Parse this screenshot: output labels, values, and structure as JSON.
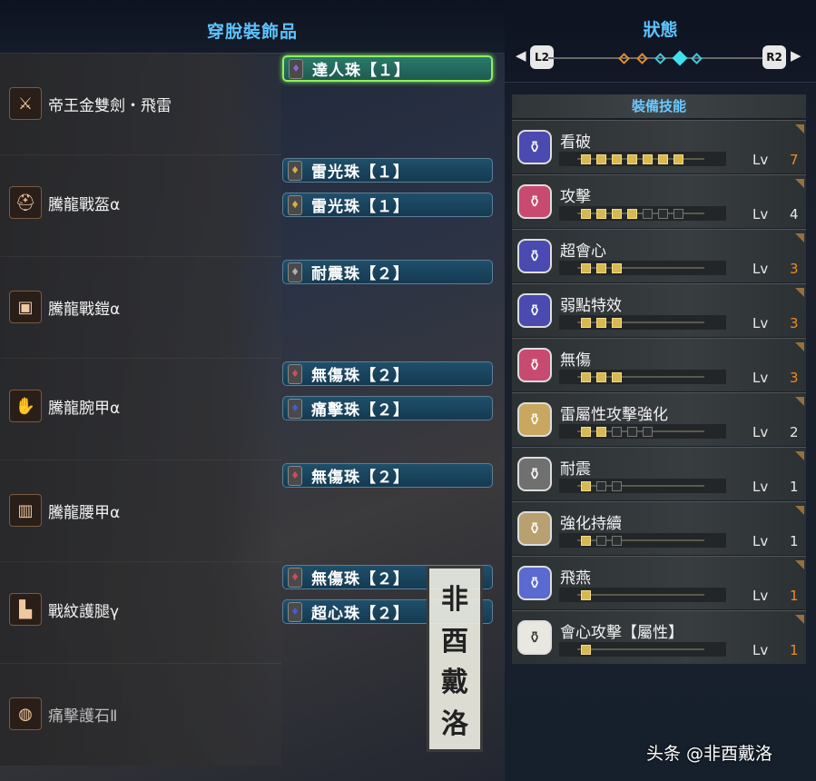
{
  "left": {
    "title": "穿脫裝飾品",
    "slots": [
      {
        "name": "帝王金雙劍・飛雷",
        "icon": "dual-blades-icon",
        "decorations": [
          {
            "label": "達人珠【１】",
            "selected": true,
            "gem": "purple"
          }
        ]
      },
      {
        "name": "騰龍戰盔α",
        "icon": "helmet-icon",
        "decorations": [
          {
            "label": "雷光珠【１】",
            "selected": false,
            "gem": "gold"
          },
          {
            "label": "雷光珠【１】",
            "selected": false,
            "gem": "gold"
          }
        ]
      },
      {
        "name": "騰龍戰鎧α",
        "icon": "chest-armor-icon",
        "decorations": [
          {
            "label": "耐震珠【２】",
            "selected": false,
            "gem": "gray"
          }
        ]
      },
      {
        "name": "騰龍腕甲α",
        "icon": "gauntlet-icon",
        "decorations": [
          {
            "label": "無傷珠【２】",
            "selected": false,
            "gem": "red"
          },
          {
            "label": "痛擊珠【２】",
            "selected": false,
            "gem": "blue"
          }
        ]
      },
      {
        "name": "騰龍腰甲α",
        "icon": "waist-armor-icon",
        "decorations": [
          {
            "label": "無傷珠【２】",
            "selected": false,
            "gem": "red"
          }
        ]
      },
      {
        "name": "戰紋護腿γ",
        "icon": "leg-armor-icon",
        "decorations": [
          {
            "label": "無傷珠【２】",
            "selected": false,
            "gem": "red"
          },
          {
            "label": "超心珠【２】",
            "selected": false,
            "gem": "blue"
          }
        ]
      },
      {
        "name": "痛擊護石Ⅱ",
        "icon": "charm-icon",
        "decorations": []
      }
    ]
  },
  "right": {
    "title": "狀態",
    "nav": {
      "left_button": "L2",
      "right_button": "R2",
      "page_count": 5,
      "active_page": 4
    },
    "skills_header": "裝備技能",
    "skills": [
      {
        "name": "看破",
        "level": 7,
        "max": 7,
        "maxed": true,
        "icon_color": "#4a4ab0"
      },
      {
        "name": "攻擊",
        "level": 4,
        "max": 7,
        "maxed": false,
        "icon_color": "#c84a70"
      },
      {
        "name": "超會心",
        "level": 3,
        "max": 3,
        "maxed": true,
        "icon_color": "#4a4ab0"
      },
      {
        "name": "弱點特效",
        "level": 3,
        "max": 3,
        "maxed": true,
        "icon_color": "#4a4ab0"
      },
      {
        "name": "無傷",
        "level": 3,
        "max": 3,
        "maxed": true,
        "icon_color": "#c84a70"
      },
      {
        "name": "雷屬性攻擊強化",
        "level": 2,
        "max": 5,
        "maxed": false,
        "icon_color": "#c8a860"
      },
      {
        "name": "耐震",
        "level": 1,
        "max": 3,
        "maxed": false,
        "icon_color": "#707070"
      },
      {
        "name": "強化持續",
        "level": 1,
        "max": 3,
        "maxed": false,
        "icon_color": "#b8a070"
      },
      {
        "name": "飛燕",
        "level": 1,
        "max": 1,
        "maxed": true,
        "icon_color": "#5a6ad0"
      },
      {
        "name": "會心攻擊【屬性】",
        "level": 1,
        "max": 1,
        "maxed": true,
        "icon_color": "#e8e8e0"
      }
    ],
    "lv_label": "Lv"
  },
  "watermark": {
    "chars": [
      "非",
      "酉",
      "戴",
      "洛"
    ]
  },
  "credit": "头条 @非酉戴洛",
  "colors": {
    "title": "#5cc3ff",
    "maxed_level": "#f08a20",
    "normal_level": "#e8e8e8"
  }
}
